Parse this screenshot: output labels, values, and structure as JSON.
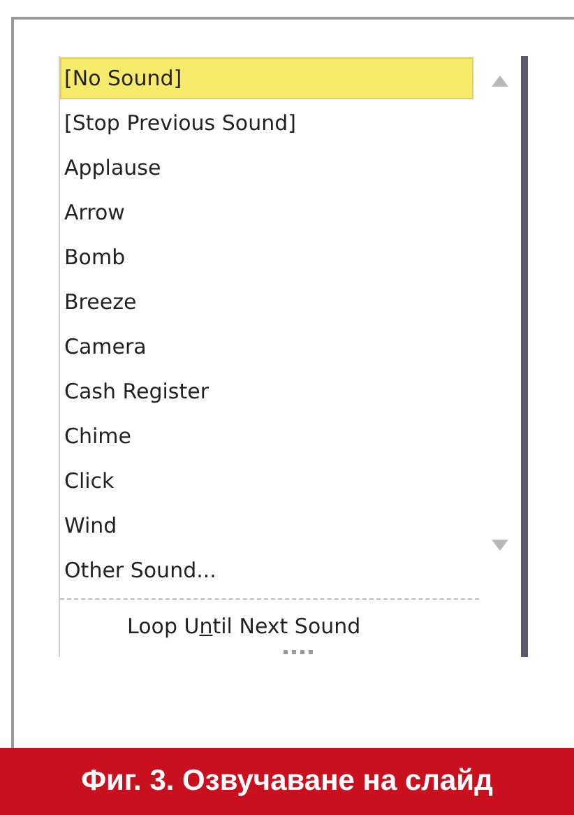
{
  "sound_list": {
    "items": [
      {
        "label": "[No Sound]",
        "selected": true
      },
      {
        "label": "[Stop Previous Sound]",
        "selected": false
      },
      {
        "label": "Applause",
        "selected": false
      },
      {
        "label": "Arrow",
        "selected": false
      },
      {
        "label": "Bomb",
        "selected": false
      },
      {
        "label": "Breeze",
        "selected": false
      },
      {
        "label": "Camera",
        "selected": false
      },
      {
        "label": "Cash Register",
        "selected": false
      },
      {
        "label": "Chime",
        "selected": false
      },
      {
        "label": "Click",
        "selected": false
      },
      {
        "label": "Wind",
        "selected": false
      },
      {
        "label": "Other Sound...",
        "selected": false
      }
    ],
    "loop_option": {
      "before": "Loop U",
      "access_key": "n",
      "after": "til Next Sound"
    }
  },
  "caption": "Фиг. 3. Озвучаване на слайд"
}
